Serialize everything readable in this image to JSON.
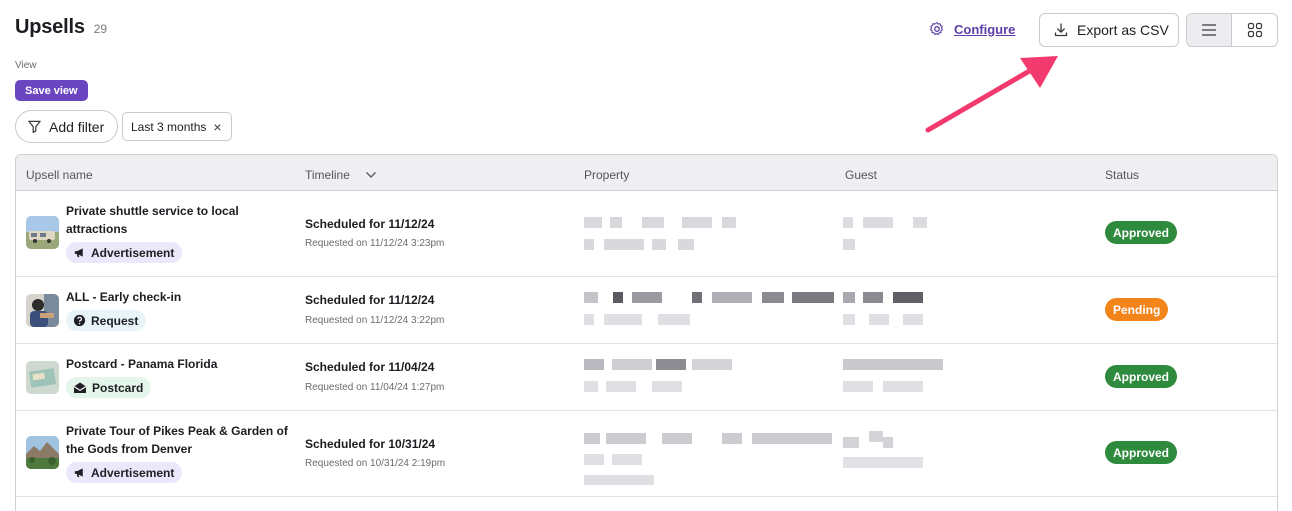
{
  "page": {
    "title": "Upsells",
    "count": "29"
  },
  "view": {
    "label": "View",
    "save_label": "Save view"
  },
  "filters": {
    "add_label": "Add filter",
    "chip_label": "Last 3 months",
    "chip_remove": "×"
  },
  "actions": {
    "configure_label": "Configure",
    "export_label": "Export as CSV"
  },
  "table": {
    "headers": {
      "name": "Upsell name",
      "timeline": "Timeline",
      "property": "Property",
      "guest": "Guest",
      "status": "Status"
    },
    "rows": [
      {
        "name": "Private shuttle service to local attractions",
        "tag": "Advertisement",
        "tag_icon": "megaphone-icon",
        "scheduled": "Scheduled for 11/12/24",
        "requested": "Requested on 11/12/24 3:23pm",
        "status": "Approved"
      },
      {
        "name": "ALL - Early check-in",
        "tag": "Request",
        "tag_icon": "question-icon",
        "scheduled": "Scheduled for 11/12/24",
        "requested": "Requested on 11/12/24 3:22pm",
        "status": "Pending"
      },
      {
        "name": "Postcard - Panama Florida",
        "tag": "Postcard",
        "tag_icon": "envelope-icon",
        "scheduled": "Scheduled for 11/04/24",
        "requested": "Requested on 11/04/24 1:27pm",
        "status": "Approved"
      },
      {
        "name": "Private Tour of Pikes Peak & Garden of the Gods from Denver",
        "tag": "Advertisement",
        "tag_icon": "megaphone-icon",
        "scheduled": "Scheduled for 10/31/24",
        "requested": "Requested on 10/31/24 2:19pm",
        "status": "Approved"
      }
    ]
  },
  "colors": {
    "accent": "#6b46c1",
    "approved": "#2e8b3e",
    "pending": "#f2841a",
    "arrow": "#f23a6e"
  }
}
